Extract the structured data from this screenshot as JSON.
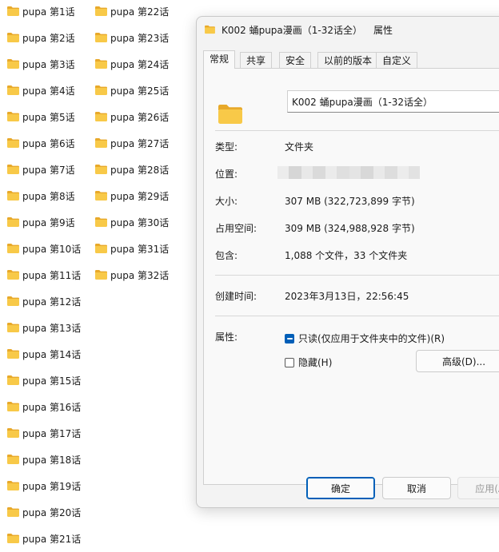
{
  "desktop": {
    "folders_col1": [
      "pupa 第1话",
      "pupa 第2话",
      "pupa 第3话",
      "pupa 第4话",
      "pupa 第5话",
      "pupa 第6话",
      "pupa 第7话",
      "pupa 第8话",
      "pupa 第9话",
      "pupa 第10话",
      "pupa 第11话",
      "pupa 第12话",
      "pupa 第13话",
      "pupa 第14话",
      "pupa 第15话",
      "pupa 第16话",
      "pupa 第17话",
      "pupa 第18话",
      "pupa 第19话",
      "pupa 第20话",
      "pupa 第21话"
    ],
    "folders_col2": [
      "pupa 第22话",
      "pupa 第23话",
      "pupa 第24话",
      "pupa 第25话",
      "pupa 第26话",
      "pupa 第27话",
      "pupa 第28话",
      "pupa 第29话",
      "pupa 第30话",
      "pupa 第31话",
      "pupa 第32话"
    ]
  },
  "dialog": {
    "title": "K002 蛹pupa漫画（1-32话全）",
    "title_suffix": "属性",
    "tabs": [
      "常规",
      "共享",
      "安全",
      "以前的版本",
      "自定义"
    ],
    "name_value": "K002 蛹pupa漫画（1-32话全）",
    "type_label": "类型:",
    "type_value": "文件夹",
    "location_label": "位置:",
    "size_label": "大小:",
    "size_value": "307 MB (322,723,899 字节)",
    "disk_label": "占用空间:",
    "disk_value": "309 MB (324,988,928 字节)",
    "contains_label": "包含:",
    "contains_value": "1,088 个文件，33 个文件夹",
    "created_label": "创建时间:",
    "created_value": "2023年3月13日，22:56:45",
    "attributes_label": "属性:",
    "readonly_label": "只读(仅应用于文件夹中的文件)(R)",
    "hidden_label": "隐藏(H)",
    "advanced_button": "高级(D)...",
    "ok_button": "确定",
    "cancel_button": "取消",
    "apply_button": "应用(A)"
  },
  "colors": {
    "folder_yellow": "#f5c343",
    "accent": "#005fb8"
  }
}
